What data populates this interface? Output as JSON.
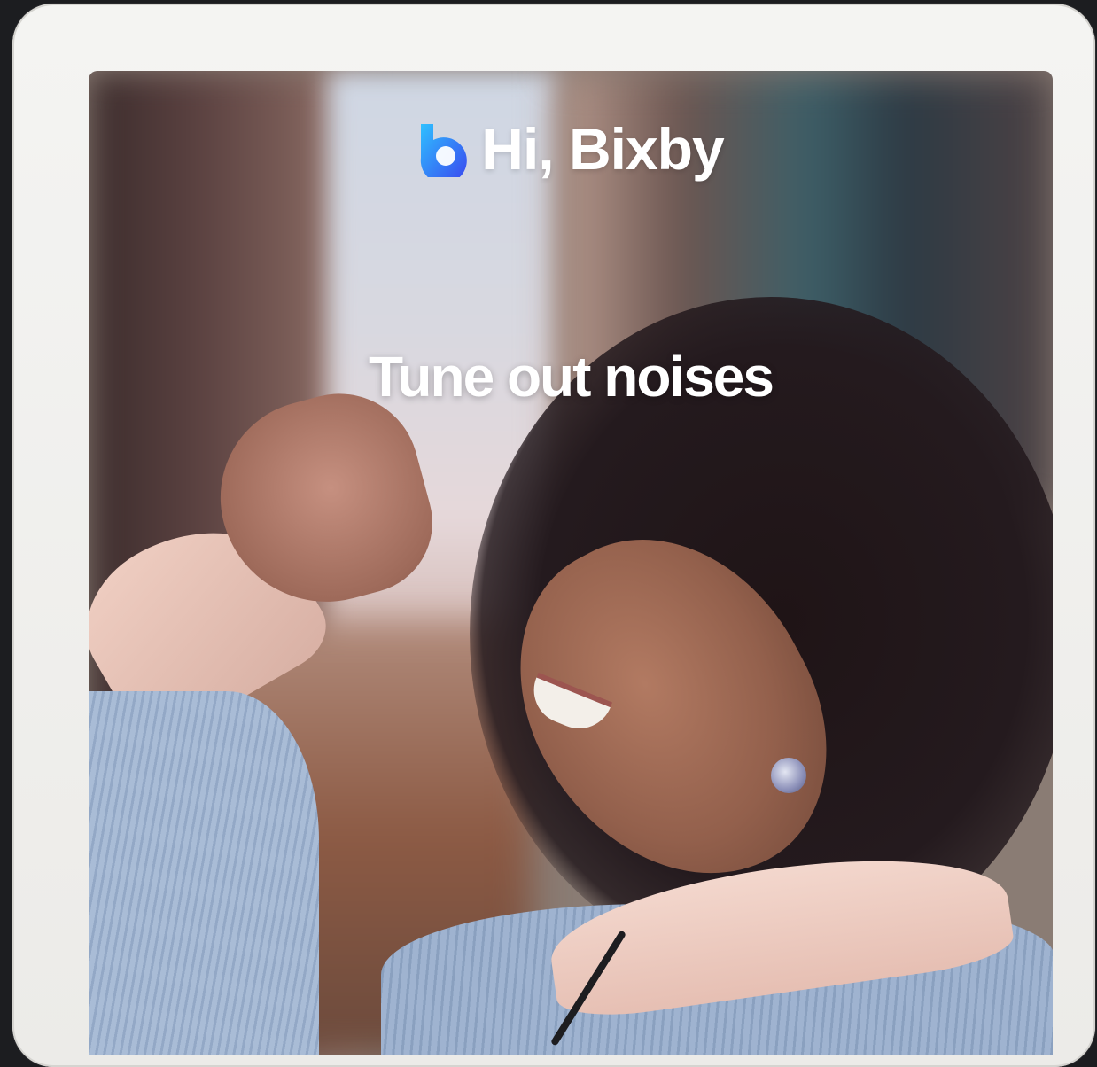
{
  "banner": {
    "brand_text": "Hi, Bixby",
    "tagline": "Tune out noises",
    "logo_icon": "bixby-logo-icon"
  },
  "colors": {
    "logo_gradient_start": "#2fb4ff",
    "logo_gradient_end": "#3b4ff0",
    "text": "#ffffff",
    "device_frame": "#f0efec"
  }
}
